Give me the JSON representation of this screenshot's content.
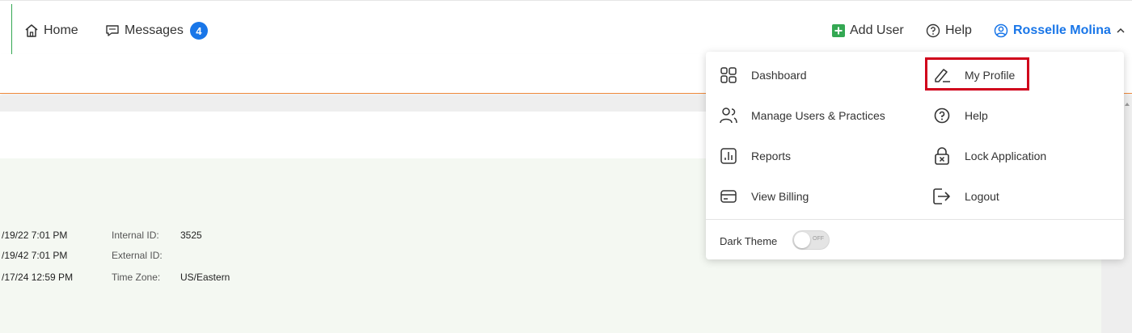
{
  "topnav": {
    "home": "Home",
    "messages": "Messages",
    "messages_count": "4",
    "add_user": "Add User",
    "help": "Help",
    "user_name": "Rosselle Molina"
  },
  "menu": {
    "dashboard": "Dashboard",
    "manage_users": "Manage Users & Practices",
    "reports": "Reports",
    "view_billing": "View Billing",
    "my_profile": "My Profile",
    "help": "Help",
    "lock_application": "Lock Application",
    "logout": "Logout",
    "dark_theme_label": "Dark Theme",
    "dark_theme_state": "OFF"
  },
  "details": {
    "rows": [
      {
        "date": "/19/22 7:01 PM",
        "label": "Internal ID:",
        "value": "3525"
      },
      {
        "date": "/19/42 7:01 PM",
        "label": "External ID:",
        "value": ""
      },
      {
        "date": "/17/24 12:59 PM",
        "label": "Time Zone:",
        "value": "US/Eastern"
      }
    ]
  },
  "colors": {
    "accent_blue": "#1976e8",
    "accent_green": "#34a853",
    "accent_orange": "#f08a3c",
    "highlight_red": "#d0021b"
  }
}
